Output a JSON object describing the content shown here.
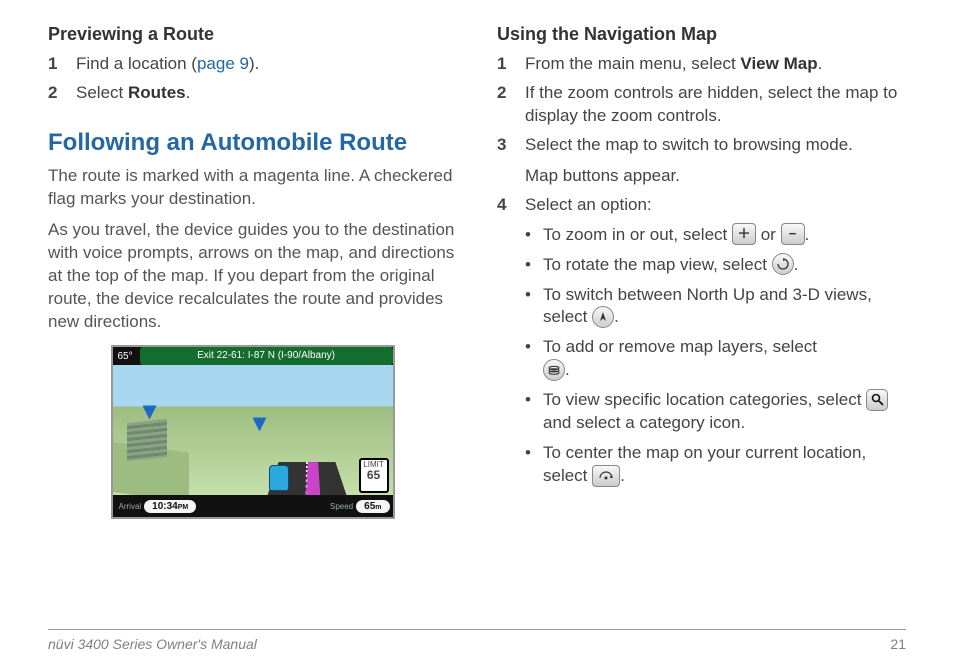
{
  "left": {
    "heading1": "Previewing a Route",
    "step1a": "Find a location (",
    "step1_link": "page 9",
    "step1b": ").",
    "step2a": "Select ",
    "step2_bold": "Routes",
    "step2b": ".",
    "heading2": "Following an Automobile Route",
    "para1": "The route is marked with a magenta line. A checkered flag marks your destination.",
    "para2": "As you travel, the device guides you to the destination with voice prompts, arrows on the map, and directions at the top of the map. If you depart from the original route, the device recalculates the route and provides new directions."
  },
  "navshot": {
    "temp": "65°",
    "exit": "Exit 22-61: I-87 N (I-90/Albany)",
    "arrival_label": "Arrival",
    "arrival": "10:34",
    "speed_label": "Speed",
    "speed": "65",
    "limit_label": "LIMIT",
    "limit": "65"
  },
  "right": {
    "heading": "Using the Navigation Map",
    "s1a": "From the main menu, select ",
    "s1b": "View Map",
    "s1c": ".",
    "s2": "If the zoom controls are hidden, select the map to display the zoom controls.",
    "s3a": "Select the map to switch to browsing mode.",
    "s3b": "Map buttons appear.",
    "s4": "Select an option:",
    "b1a": "To zoom in or out, select ",
    "b1b": " or ",
    "b1c": ".",
    "b2a": "To rotate the map view, select ",
    "b2b": ".",
    "b3a": "To switch between North Up and 3-D views, select ",
    "b3b": ".",
    "b4a": "To add or remove map layers, select ",
    "b4b": ".",
    "b5a": "To view specific location categories, select ",
    "b5b": " and select a category icon.",
    "b6a": "To center the map on your current location, select ",
    "b6b": "."
  },
  "icons": {
    "plus": "＋",
    "minus": "−"
  },
  "footer": {
    "title": "nüvi 3400 Series Owner's Manual",
    "page": "21"
  }
}
